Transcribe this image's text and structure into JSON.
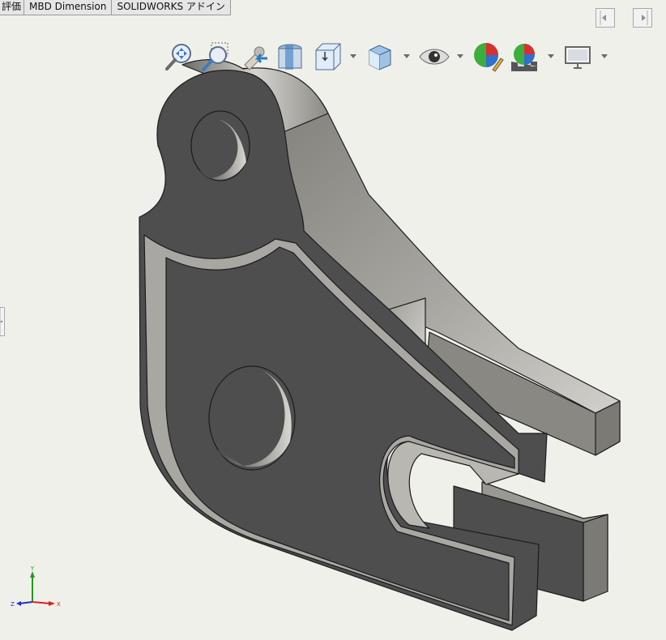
{
  "tabs": [
    {
      "label": "評価"
    },
    {
      "label": "MBD Dimension"
    },
    {
      "label": "SOLIDWORKS アドイン"
    }
  ],
  "toolbar": {
    "items": [
      {
        "icon": "zoom-to-fit-icon"
      },
      {
        "icon": "zoom-to-area-icon"
      },
      {
        "icon": "previous-view-icon"
      },
      {
        "icon": "section-view-icon"
      },
      {
        "icon": "view-orientation-icon",
        "dropdown": true
      },
      {
        "icon": "display-style-icon",
        "dropdown": true
      },
      {
        "icon": "hide-show-items-icon",
        "dropdown": true
      },
      {
        "icon": "edit-appearance-icon"
      },
      {
        "icon": "apply-scene-icon",
        "dropdown": true
      },
      {
        "icon": "view-settings-icon",
        "dropdown": true
      }
    ]
  },
  "model": {
    "part": "bracket",
    "face_color": "#4e4e4e",
    "edge_color": "#1c1c1c",
    "side_color": "#8a8882"
  },
  "triad": {
    "x_label": "X",
    "y_label": "Y",
    "z_label": "Z",
    "x_color": "#d82020",
    "y_color": "#1f9a1f",
    "z_color": "#2030c8"
  },
  "colors": {
    "background": "#f0f0ea"
  }
}
